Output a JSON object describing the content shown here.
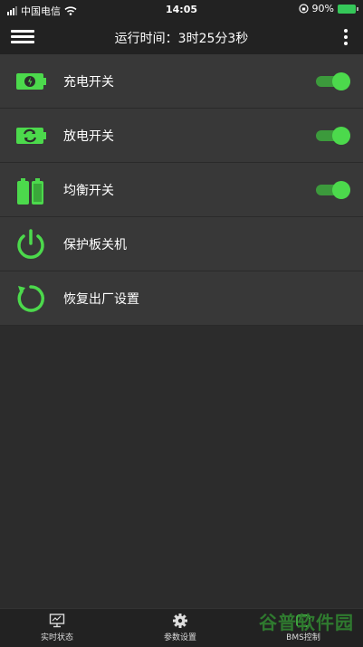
{
  "status_bar": {
    "carrier": "中国电信",
    "time": "14:05",
    "battery": "90%"
  },
  "nav": {
    "title": "运行时间：3时25分3秒"
  },
  "list": [
    {
      "label": "充电开关",
      "icon": "battery-charge-icon",
      "has_toggle": true,
      "toggle_on": true
    },
    {
      "label": "放电开关",
      "icon": "battery-discharge-icon",
      "has_toggle": true,
      "toggle_on": true
    },
    {
      "label": "均衡开关",
      "icon": "battery-balance-icon",
      "has_toggle": true,
      "toggle_on": true
    },
    {
      "label": "保护板关机",
      "icon": "power-icon",
      "has_toggle": false
    },
    {
      "label": "恢复出厂设置",
      "icon": "reset-icon",
      "has_toggle": false
    }
  ],
  "tabs": [
    {
      "label": "实时状态",
      "icon": "monitor-icon"
    },
    {
      "label": "参数设置",
      "icon": "gear-icon"
    },
    {
      "label": "BMS控制",
      "icon": "control-icon"
    }
  ],
  "watermark": "谷普软件园",
  "colors": {
    "accent": "#4cd94c",
    "row_bg": "#383838",
    "page_bg": "#2c2c2c",
    "bar_bg": "#222222"
  }
}
